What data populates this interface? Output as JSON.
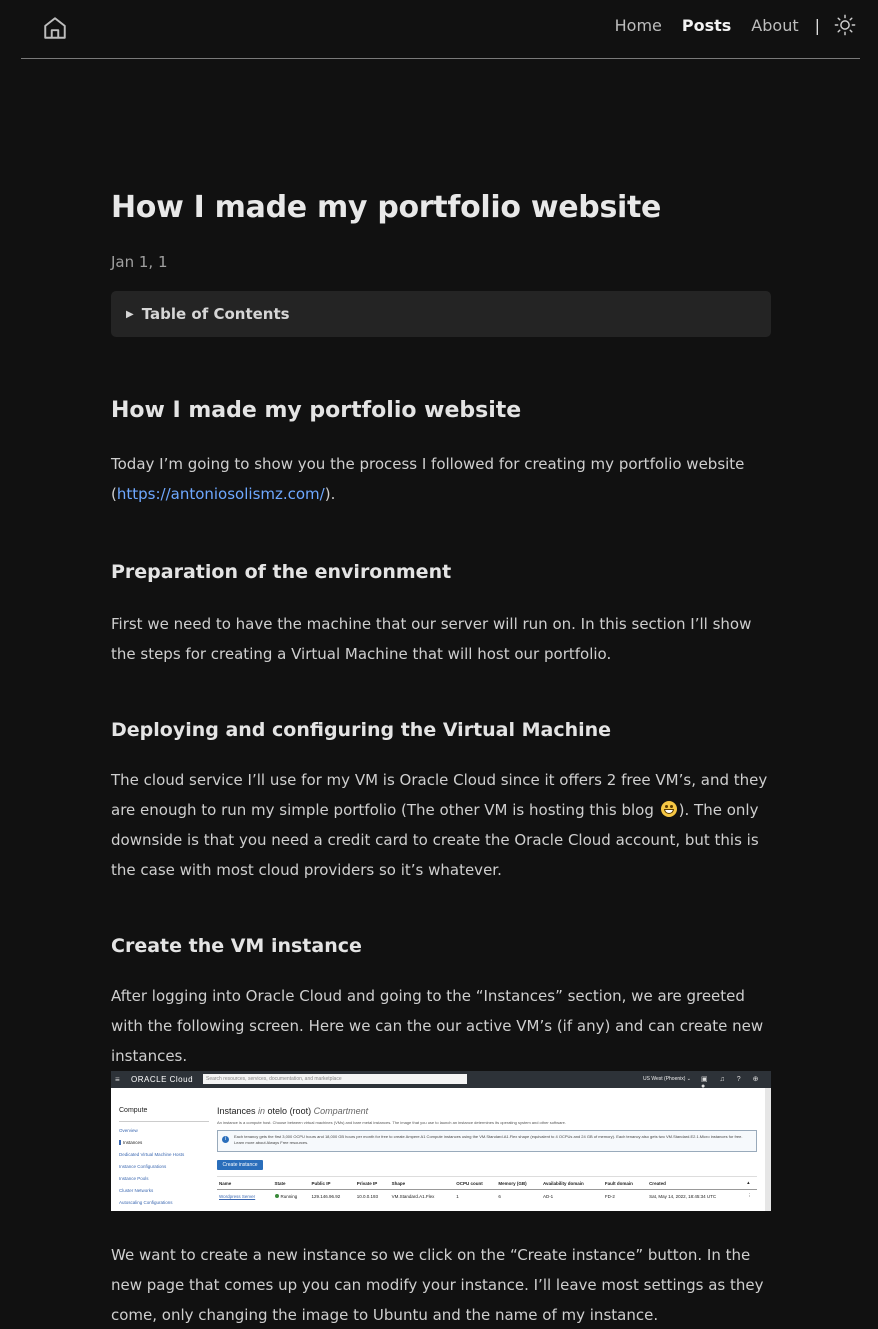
{
  "header": {
    "home_icon": "home-icon",
    "nav": [
      {
        "label": "Home",
        "active": false
      },
      {
        "label": "Posts",
        "active": true
      },
      {
        "label": "About",
        "active": false
      }
    ],
    "separator": "|",
    "theme_icon": "sun-icon"
  },
  "post": {
    "title": "How I made my portfolio website",
    "date": "Jan 1, 1",
    "toc_label": "Table of Contents",
    "sections": {
      "s1_heading": "How I made my portfolio website",
      "s1_text_before": "Today I’m going to show you the process I followed for creating my portfolio website (",
      "s1_link": "https://antoniosolismz.com/",
      "s1_text_after": ").",
      "s2_heading": "Preparation of the environment",
      "s2_text": "First we need to have the machine that our server will run on. In this section I’ll show the steps for creating a Virtual Machine that will host our portfolio.",
      "s3_heading": "Deploying and configuring the Virtual Machine",
      "s3_text_before": "The cloud service I’ll use for my VM is Oracle Cloud since it offers 2 free VM’s, and they are enough to run my simple portfolio (The other VM is hosting this blog",
      "s3_text_after": "). The only downside is that you need a credit card to create the Oracle Cloud account, but this is the case with most cloud providers so it’s whatever.",
      "s4_heading": "Create the VM instance",
      "s4_text": "After logging into Oracle Cloud and going to the “Instances” section, we are greeted with the following screen. Here we can the our active VM’s (if any) and can create new instances.",
      "s5_text": "We want to create a new instance so we click on the “Create instance” button. In the new page that comes up you can modify your instance. I’ll leave most settings as they come, only changing the image to Ubuntu and the name of my instance."
    }
  },
  "screenshot": {
    "menu": "≡",
    "logo": "ORACLE Cloud",
    "search_placeholder": "Search resources, services, documentation, and marketplace",
    "region": "US West (Phoenix) ⌄",
    "tools": "▣ ♫ ? ⊕ ●",
    "side_title": "Compute",
    "side_items": [
      "Overview",
      "Instances",
      "Dedicated Virtual Machine Hosts",
      "Instance Configurations",
      "Instance Pools",
      "Cluster Networks",
      "Autoscaling Configurations"
    ],
    "heading_a": "Instances ",
    "heading_in": "in",
    "heading_b": " otelo (root) ",
    "heading_c": "Compartment",
    "subtext": "An instance is a compute host. Choose between virtual machines (VMs) and bare metal instances. The image that you use to launch an instance determines its operating system and other software.",
    "info": "Each tenancy gets the first 3,000 OCPU hours and 18,000 GB hours per month for free to create Ampere A1 Compute instances using the VM.Standard.A1.Flex shape (equivalent to 4 OCPUs and 24 GB of memory). Each tenancy also gets two VM.Standard.E2.1.Micro instances for free. Learn more about Always Free resources.",
    "button": "Create instance",
    "columns": [
      "Name",
      "State",
      "Public IP",
      "Private IP",
      "Shape",
      "OCPU count",
      "Memory (GB)",
      "Availability domain",
      "Fault domain",
      "Created",
      "▴"
    ],
    "row": [
      "Wordpress Server",
      "Running",
      "129.146.96.92",
      "10.0.0.193",
      "VM.Standard.A1.Flex",
      "1",
      "6",
      "AD-1",
      "FD-2",
      "Sat, May 14, 2022, 18:45:34 UTC",
      "⋮"
    ]
  }
}
